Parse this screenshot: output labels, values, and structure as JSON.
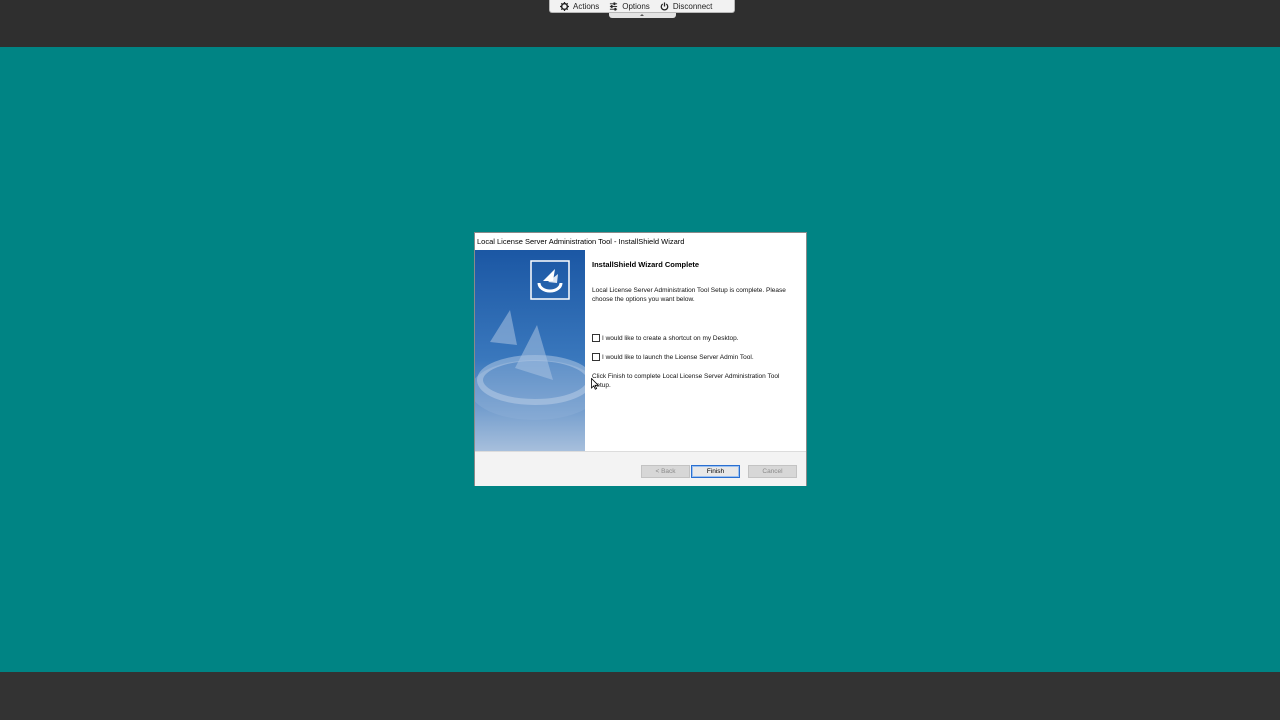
{
  "toolbar": {
    "actions_label": "Actions",
    "options_label": "Options",
    "disconnect_label": "Disconnect",
    "icons": {
      "actions": "gear-icon",
      "options": "sliders-icon",
      "disconnect": "power-icon"
    }
  },
  "wizard": {
    "title": "Local License Server Administration Tool - InstallShield Wizard",
    "heading": "InstallShield Wizard Complete",
    "description": "Local License Server Administration Tool Setup is complete. Please choose the options you want below.",
    "options": [
      {
        "label": "I would like to create a shortcut on my Desktop.",
        "checked": false
      },
      {
        "label": "I would like to launch the License Server Admin Tool.",
        "checked": false
      }
    ],
    "note": "Click Finish to complete Local License Server Administration Tool Setup.",
    "buttons": {
      "back": "< Back",
      "finish": "Finish",
      "cancel": "Cancel"
    }
  },
  "colors": {
    "desktop": "#008484",
    "frame": "#333333",
    "side_panel_blue": "#1d5fa8",
    "focus_border": "#2a6fd0"
  }
}
